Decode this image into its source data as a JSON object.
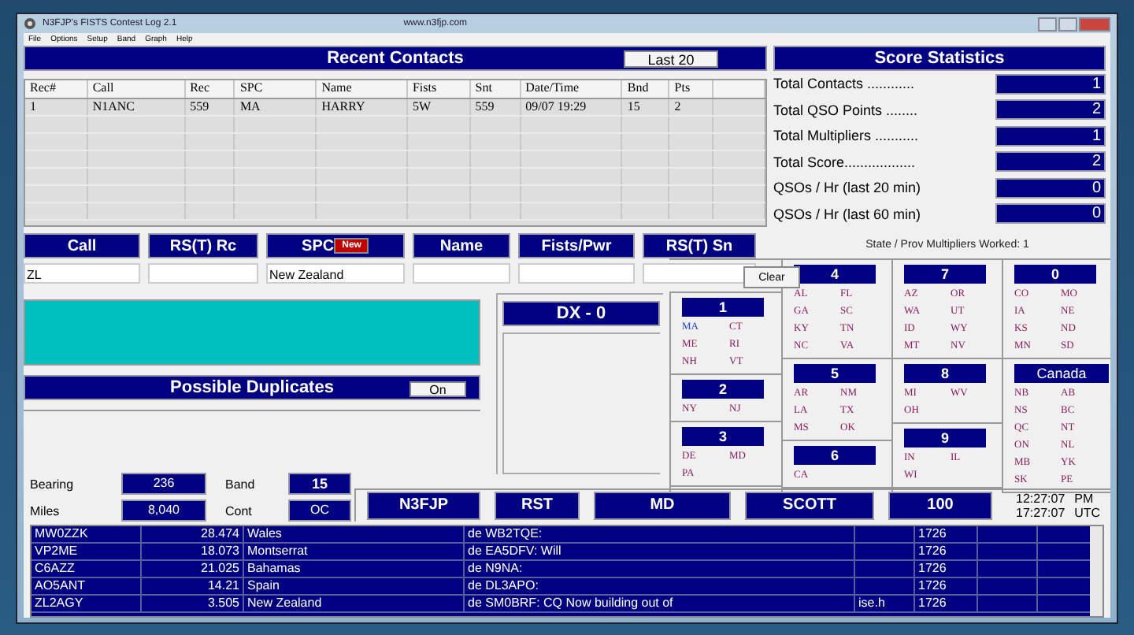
{
  "window": {
    "title": "N3FJP's FISTS Contest Log 2.1",
    "url": "www.n3fjp.com"
  },
  "menu": [
    "File",
    "Options",
    "Setup",
    "Band",
    "Graph",
    "Help"
  ],
  "recent_contacts": {
    "title": "Recent Contacts",
    "button": "Last 20",
    "columns": [
      "Rec#",
      "Call",
      "Rec",
      "SPC",
      "Name",
      "Fists",
      "Snt",
      "Date/Time",
      "Bnd",
      "Pts"
    ],
    "rows": [
      [
        "1",
        "N1ANC",
        "559",
        "MA",
        "HARRY",
        "5W",
        "559",
        "09/07 19:29",
        "15",
        "2"
      ]
    ]
  },
  "score_statistics": {
    "title": "Score Statistics",
    "rows": [
      {
        "label": "Total Contacts ............",
        "value": "1"
      },
      {
        "label": "Total QSO Points ........",
        "value": "2"
      },
      {
        "label": "Total Multipliers ...........",
        "value": "1"
      },
      {
        "label": "Total Score..................",
        "value": "2"
      },
      {
        "label": "QSOs / Hr (last 20 min)",
        "value": "0"
      },
      {
        "label": "QSOs / Hr (last 60 min)",
        "value": "0"
      }
    ]
  },
  "entry_fields": [
    {
      "label": "Call",
      "value": "ZL"
    },
    {
      "label": "RS(T) Rc"
    },
    {
      "label": "SPC",
      "value": "New Zealand",
      "badge": "New"
    },
    {
      "label": "Name"
    },
    {
      "label": "Fists/Pwr"
    },
    {
      "label": "RS(T) Sn"
    }
  ],
  "clear_button": "Clear",
  "multipliers": {
    "title": "State / Prov Multipliers Worked: 1",
    "columns": [
      [
        {
          "label": "1",
          "states": [
            {
              "code": "MA",
              "worked": true
            },
            {
              "code": "CT",
              "worked": false
            },
            {
              "code": "ME",
              "worked": false
            },
            {
              "code": "RI",
              "worked": false
            },
            {
              "code": "NH",
              "worked": false
            },
            {
              "code": "VT",
              "worked": false
            }
          ]
        },
        {
          "label": "2",
          "states": [
            {
              "code": "NY",
              "worked": false
            },
            {
              "code": "NJ",
              "worked": false
            }
          ]
        },
        {
          "label": "3",
          "states": [
            {
              "code": "DE",
              "worked": false
            },
            {
              "code": "MD",
              "worked": false
            },
            {
              "code": "PA",
              "worked": false
            }
          ]
        }
      ],
      [
        {
          "label": "4",
          "states": [
            {
              "code": "AL",
              "worked": false
            },
            {
              "code": "FL",
              "worked": false
            },
            {
              "code": "GA",
              "worked": false
            },
            {
              "code": "SC",
              "worked": false
            },
            {
              "code": "KY",
              "worked": false
            },
            {
              "code": "TN",
              "worked": false
            },
            {
              "code": "NC",
              "worked": false
            },
            {
              "code": "VA",
              "worked": false
            }
          ]
        },
        {
          "label": "5",
          "states": [
            {
              "code": "AR",
              "worked": false
            },
            {
              "code": "NM",
              "worked": false
            },
            {
              "code": "LA",
              "worked": false
            },
            {
              "code": "TX",
              "worked": false
            },
            {
              "code": "MS",
              "worked": false
            },
            {
              "code": "OK",
              "worked": false
            }
          ]
        },
        {
          "label": "6",
          "states": [
            {
              "code": "CA",
              "worked": false
            }
          ]
        }
      ],
      [
        {
          "label": "7",
          "states": [
            {
              "code": "AZ",
              "worked": false
            },
            {
              "code": "OR",
              "worked": false
            },
            {
              "code": "WA",
              "worked": false
            },
            {
              "code": "UT",
              "worked": false
            },
            {
              "code": "ID",
              "worked": false
            },
            {
              "code": "WY",
              "worked": false
            },
            {
              "code": "MT",
              "worked": false
            },
            {
              "code": "NV",
              "worked": false
            }
          ]
        },
        {
          "label": "8",
          "states": [
            {
              "code": "MI",
              "worked": false
            },
            {
              "code": "WV",
              "worked": false
            },
            {
              "code": "OH",
              "worked": false
            }
          ]
        },
        {
          "label": "9",
          "states": [
            {
              "code": "IN",
              "worked": false
            },
            {
              "code": "IL",
              "worked": false
            },
            {
              "code": "WI",
              "worked": false
            }
          ]
        }
      ],
      [
        {
          "label": "0",
          "states": [
            {
              "code": "CO",
              "worked": false
            },
            {
              "code": "MO",
              "worked": false
            },
            {
              "code": "IA",
              "worked": false
            },
            {
              "code": "NE",
              "worked": false
            },
            {
              "code": "KS",
              "worked": false
            },
            {
              "code": "ND",
              "worked": false
            },
            {
              "code": "MN",
              "worked": false
            },
            {
              "code": "SD",
              "worked": false
            }
          ]
        },
        {
          "label": "Canada",
          "states": [
            {
              "code": "NB",
              "worked": false
            },
            {
              "code": "AB",
              "worked": false
            },
            {
              "code": "NS",
              "worked": false
            },
            {
              "code": "BC",
              "worked": false
            },
            {
              "code": "QC",
              "worked": false
            },
            {
              "code": "NT",
              "worked": false
            },
            {
              "code": "ON",
              "worked": false
            },
            {
              "code": "NL",
              "worked": false
            },
            {
              "code": "MB",
              "worked": false
            },
            {
              "code": "YK",
              "worked": false
            },
            {
              "code": "SK",
              "worked": false
            },
            {
              "code": "PE",
              "worked": false
            }
          ]
        }
      ]
    ]
  },
  "duplicates": {
    "title": "Possible Duplicates",
    "button": "On"
  },
  "dx": {
    "title": "DX  -  0"
  },
  "info": [
    {
      "label": "Bearing",
      "value": "236"
    },
    {
      "label": "Band",
      "value": "15"
    },
    {
      "label": "Miles",
      "value": "8,040"
    },
    {
      "label": "Cont",
      "value": "OC"
    }
  ],
  "exchange": [
    "N3FJP",
    "RST",
    "MD",
    "SCOTT",
    "100"
  ],
  "clock": [
    {
      "time": "12:27:07",
      "suffix": "PM"
    },
    {
      "time": "17:27:07",
      "suffix": "UTC"
    }
  ],
  "cluster": {
    "rows": [
      [
        "MW0ZZK",
        "28.474",
        "Wales",
        "de WB2TQE:",
        "",
        "1726"
      ],
      [
        "VP2ME",
        "18.073",
        "Montserrat",
        "de EA5DFV:  Will",
        "",
        "1726"
      ],
      [
        "C6AZZ",
        "21.025",
        "Bahamas",
        "de N9NA:",
        "",
        "1726"
      ],
      [
        "AO5ANT",
        "14.21",
        "Spain",
        "de DL3APO:",
        "",
        "1726"
      ],
      [
        "ZL2AGY",
        "3.505",
        "New Zealand",
        "de SM0BRF:  CQ Now building out of",
        "ise.h",
        "1726"
      ]
    ]
  }
}
